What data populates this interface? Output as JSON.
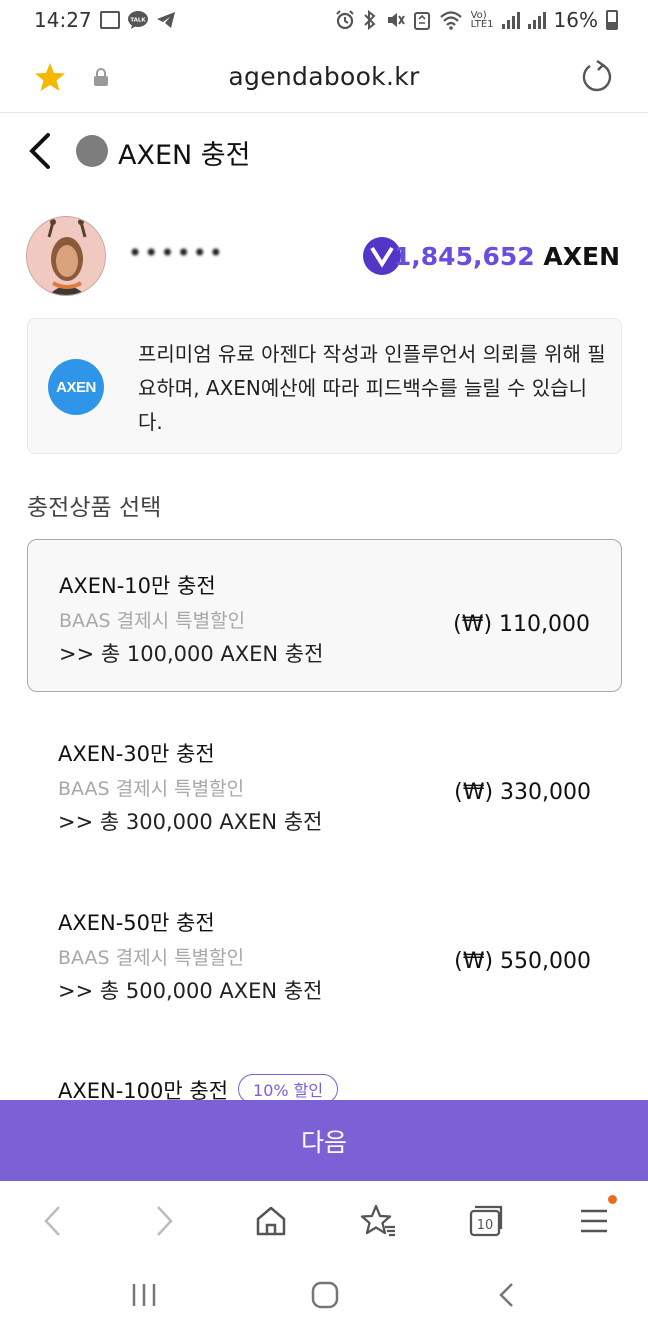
{
  "status_bar": {
    "time": "14:27",
    "talk_label": "TALK",
    "volte_label": "Vo)",
    "lte_label": "LTE1",
    "battery": "16%"
  },
  "browser": {
    "url": "agendabook.kr"
  },
  "header": {
    "title": "AXEN 충전"
  },
  "user": {
    "name": "••••••",
    "balance_amount": "1,845,652",
    "balance_unit": "AXEN"
  },
  "info": {
    "logo_text": "AXEN",
    "text": "프리미엄 유료 아젠다 작성과 인플루언서 의뢰를 위해 필요하며, AXEN예산에 따라 피드백수를 늘릴 수 있습니다."
  },
  "section_title": "충전상품 선택",
  "products": [
    {
      "name": "AXEN-10만 충전",
      "sub": "BAAS 결제시 특별할인",
      "total": ">> 총 100,000 AXEN 충전",
      "price": "(₩) 110,000"
    },
    {
      "name": "AXEN-30만 충전",
      "sub": "BAAS 결제시 특별할인",
      "total": ">> 총 300,000 AXEN 충전",
      "price": "(₩) 330,000"
    },
    {
      "name": "AXEN-50만 충전",
      "sub": "BAAS 결제시 특별할인",
      "total": ">> 총 500,000 AXEN 충전",
      "price": "(₩) 550,000"
    },
    {
      "name": "AXEN-100만 충전",
      "badge": "10% 할인"
    }
  ],
  "next_label": "다음",
  "browser_nav": {
    "tabs_count": "10"
  },
  "colors": {
    "accent": "#7c60d5",
    "axen_logo": "#2f95e9",
    "star": "#f5b800",
    "notification_dot": "#ec6a25"
  },
  "icons": [
    "image-icon",
    "talk-icon",
    "telegram-icon",
    "alarm-icon",
    "bluetooth-icon",
    "mute-icon",
    "recycle-icon",
    "wifi-icon",
    "signal-icon",
    "battery-icon",
    "star-icon",
    "lock-icon",
    "reload-icon",
    "back-icon",
    "home-icon",
    "bookmarks-icon",
    "tabs-icon",
    "menu-icon"
  ]
}
